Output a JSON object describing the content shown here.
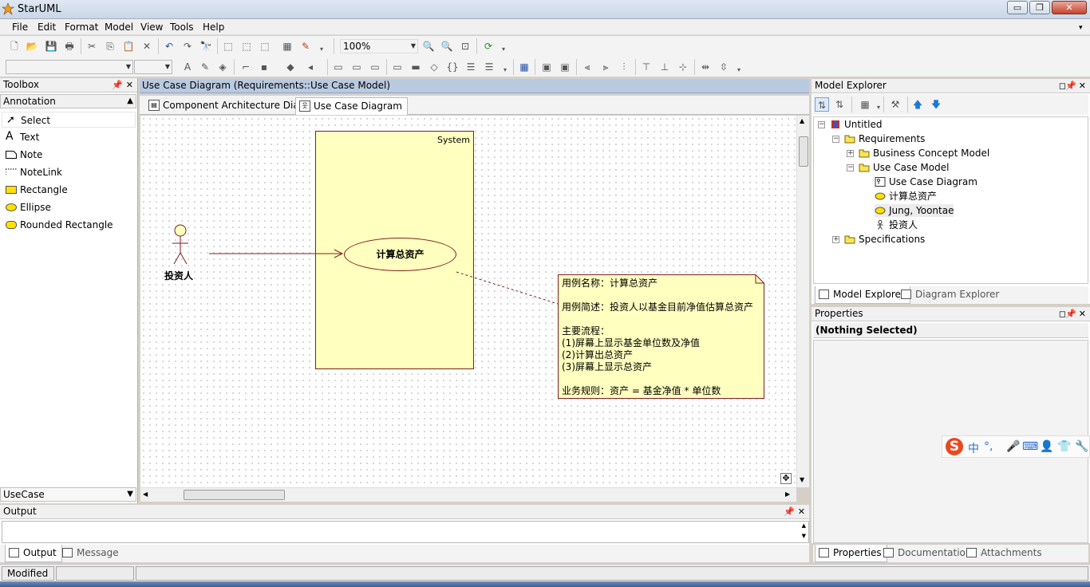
{
  "window": {
    "title": "StarUML",
    "controls": {
      "minimize": "▭",
      "maximize": "❐",
      "close": "✕"
    }
  },
  "menu": [
    "File",
    "Edit",
    "Format",
    "Model",
    "View",
    "Tools",
    "Help"
  ],
  "toolbar": {
    "zoom_value": "100%",
    "font_combo": "",
    "size_combo": ""
  },
  "toolbox": {
    "title": "Toolbox",
    "category": "Annotation",
    "items": [
      {
        "label": "Select",
        "icon": "pointer-icon"
      },
      {
        "label": "Text",
        "icon": "text-icon"
      },
      {
        "label": "Note",
        "icon": "note-icon"
      },
      {
        "label": "NoteLink",
        "icon": "notelink-icon"
      },
      {
        "label": "Rectangle",
        "icon": "rectangle-icon"
      },
      {
        "label": "Ellipse",
        "icon": "ellipse-icon"
      },
      {
        "label": "Rounded Rectangle",
        "icon": "rounded-rectangle-icon"
      }
    ],
    "bottom_category": "UseCase"
  },
  "diagram": {
    "title": "Use Case Diagram (Requirements::Use Case Model)",
    "tabs": [
      {
        "label": "Component Architecture Diagram",
        "active": false
      },
      {
        "label": "Use Case Diagram",
        "active": true
      }
    ],
    "system_label": "System",
    "usecase_label": "计算总资产",
    "actor_label": "投资人",
    "note_text": "用例名称：计算总资产\n\n用例简述：投资人以基金目前净值估算总资产\n\n主要流程：\n(1)屏幕上显示基金单位数及净值\n(2)计算出总资产\n(3)屏幕上显示总资产\n\n业务规则：资产 = 基金净值 * 单位数",
    "colors": {
      "shape_fill": "#ffffc0",
      "shape_border": "#7f1f1f",
      "title_bar": "#b9c9e0"
    }
  },
  "model_explorer": {
    "title": "Model Explorer",
    "tree": [
      {
        "label": "Untitled",
        "level": 0,
        "expander": "⊟",
        "icon": "project-icon"
      },
      {
        "label": "Requirements",
        "level": 1,
        "expander": "⊟",
        "icon": "package-icon"
      },
      {
        "label": "Business Concept Model",
        "level": 2,
        "expander": "⊞",
        "icon": "package-icon"
      },
      {
        "label": "Use Case Model",
        "level": 2,
        "expander": "⊟",
        "icon": "package-icon"
      },
      {
        "label": "Use Case Diagram",
        "level": 3,
        "expander": "",
        "icon": "diagram-icon"
      },
      {
        "label": "计算总资产",
        "level": 3,
        "expander": "",
        "icon": "usecase-icon"
      },
      {
        "label": "Jung, Yoontae",
        "level": 3,
        "expander": "",
        "icon": "usecase-icon",
        "selected": true
      },
      {
        "label": "投资人",
        "level": 3,
        "expander": "",
        "icon": "actor-icon"
      },
      {
        "label": "Specifications",
        "level": 1,
        "expander": "⊞",
        "icon": "package-icon"
      }
    ],
    "tabs": [
      {
        "label": "Model Explorer",
        "active": true
      },
      {
        "label": "Diagram Explorer",
        "active": false
      }
    ]
  },
  "properties": {
    "title": "Properties",
    "selected": "(Nothing Selected)",
    "tabs": [
      {
        "label": "Properties",
        "active": true
      },
      {
        "label": "Documentation",
        "active": false
      },
      {
        "label": "Attachments",
        "active": false
      }
    ]
  },
  "output": {
    "title": "Output",
    "tabs": [
      {
        "label": "Output",
        "active": true
      },
      {
        "label": "Message",
        "active": false
      }
    ]
  },
  "status": {
    "state": "Modified"
  },
  "ime": {
    "mode": "中",
    "punct": "°,"
  }
}
